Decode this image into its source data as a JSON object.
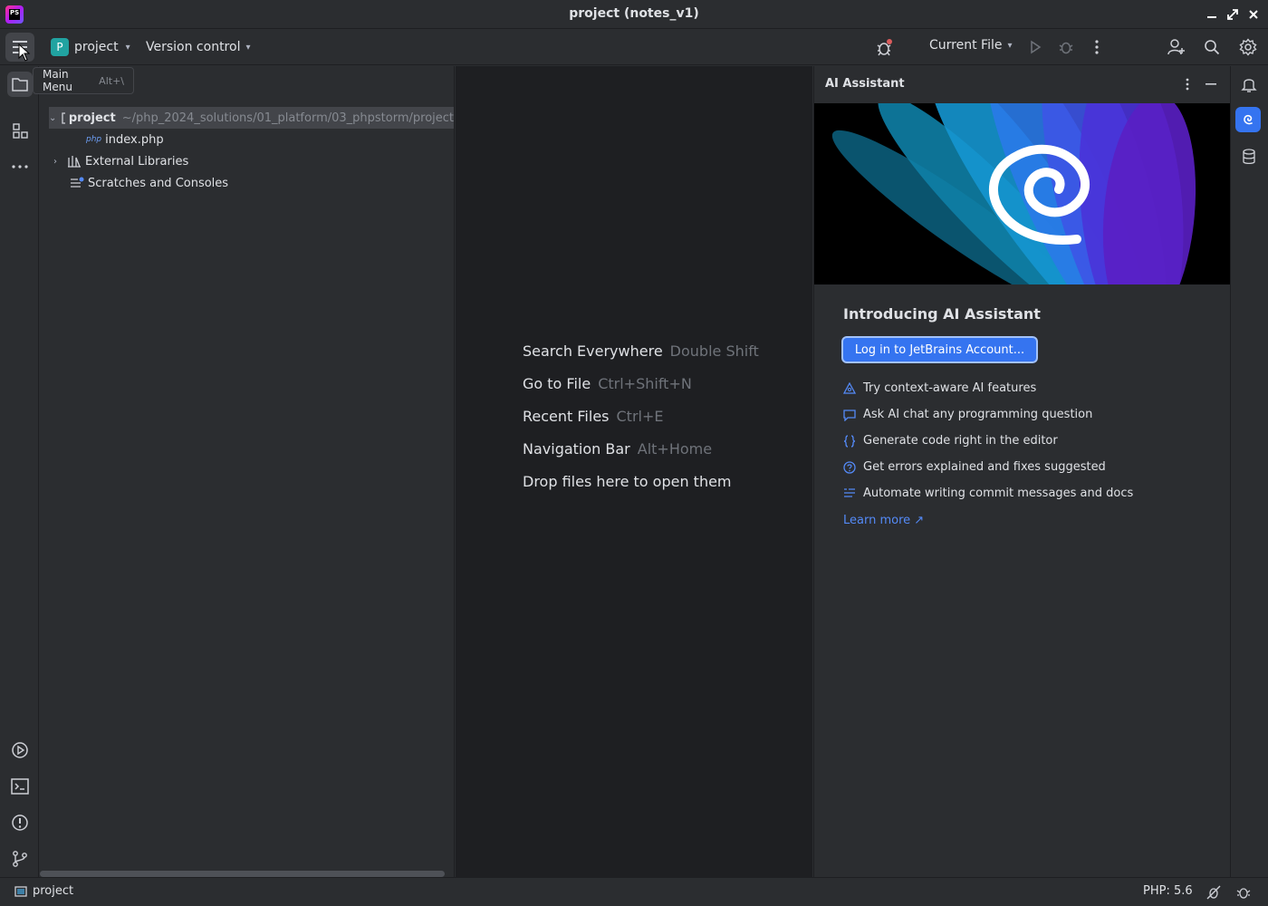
{
  "window": {
    "title": "project (notes_v1)",
    "app_logo_text": "PS"
  },
  "toolbar": {
    "project_badge": "P",
    "project_name": "project",
    "vcs_label": "Version control",
    "run_config": "Current File"
  },
  "tooltip": {
    "label": "Main Menu",
    "shortcut": "Alt+\\"
  },
  "project_tree": {
    "root": {
      "name": "project",
      "path": "~/php_2024_solutions/01_platform/03_phpstorm/project"
    },
    "items": [
      {
        "name": "index.php",
        "tag": "php"
      },
      {
        "name": "External Libraries"
      },
      {
        "name": "Scratches and Consoles"
      }
    ]
  },
  "editor_hints": [
    {
      "label": "Search Everywhere",
      "key": "Double Shift"
    },
    {
      "label": "Go to File",
      "key": "Ctrl+Shift+N"
    },
    {
      "label": "Recent Files",
      "key": "Ctrl+E"
    },
    {
      "label": "Navigation Bar",
      "key": "Alt+Home"
    },
    {
      "label": "Drop files here to open them",
      "key": ""
    }
  ],
  "ai_assistant": {
    "title": "AI Assistant",
    "heading": "Introducing AI Assistant",
    "login_button": "Log in to JetBrains Account...",
    "features": [
      "Try context-aware AI features",
      "Ask AI chat any programming question",
      "Generate code right in the editor",
      "Get errors explained and fixes suggested",
      "Automate writing commit messages and docs"
    ],
    "learn_more": "Learn more ↗"
  },
  "statusbar": {
    "project": "project",
    "php_version": "PHP: 5.6"
  },
  "colors": {
    "accent": "#3574f0",
    "link": "#548af7",
    "background": "#2b2d30",
    "editor": "#1e1f22"
  }
}
